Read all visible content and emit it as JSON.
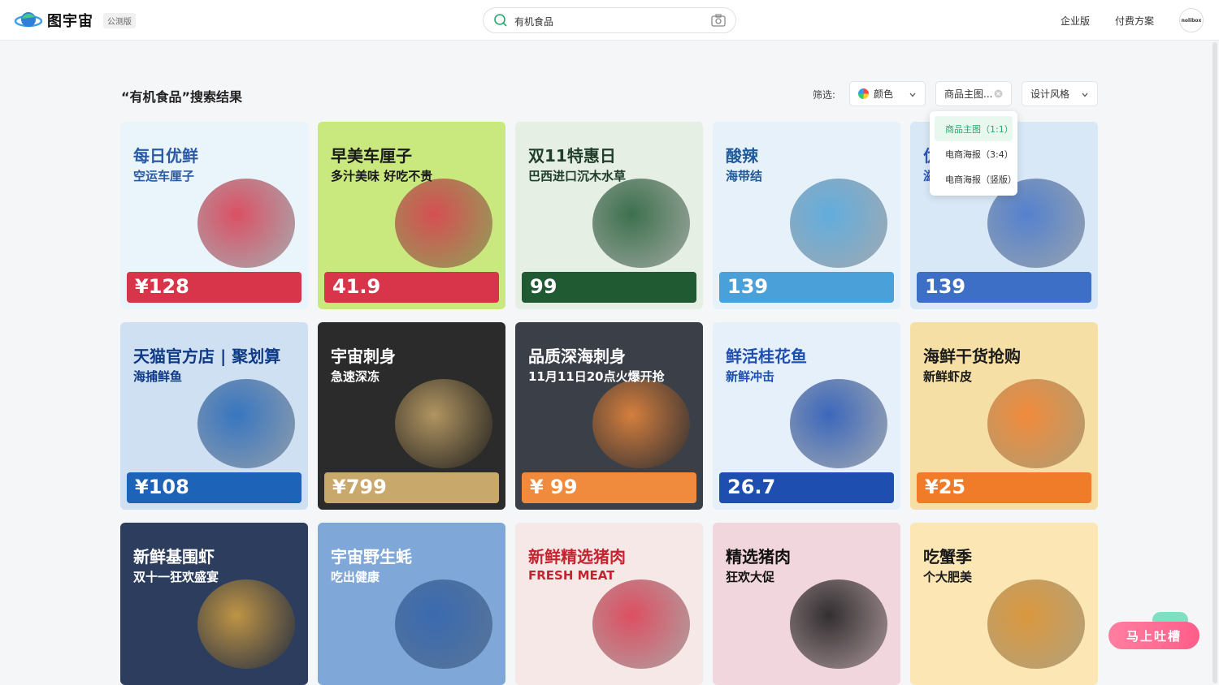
{
  "header": {
    "logo_text": "图宇宙",
    "beta_badge": "公测版",
    "search_value": "有机食品",
    "nav_enterprise": "企业版",
    "nav_pricing": "付费方案",
    "avatar_text": "nolibox"
  },
  "results": {
    "title": "“有机食品”搜索结果",
    "filter_label": "筛选:",
    "filter_color": "颜色",
    "filter_product": "商品主图...",
    "filter_style": "设计风格",
    "dropdown": [
      "商品主图（1:1）",
      "电商海报（3:4）",
      "电商海报（竖版）"
    ]
  },
  "cards": [
    {
      "t1": "每日优鲜",
      "t2": "空运车厘子",
      "price": "¥128",
      "bg": "#eaf5fb",
      "accent": "#d8344a",
      "tcolor": "#2b5aa3"
    },
    {
      "t1": "早美车厘子",
      "t2": "多汁美味 好吃不贵",
      "price": "41.9",
      "bg": "#c9e87e",
      "accent": "#d8344a",
      "tcolor": "#1a1a1a"
    },
    {
      "t1": "双11特惠日",
      "t2": "巴西进口沉木水草",
      "price": "99",
      "bg": "#e5efe4",
      "accent": "#1f5a33",
      "tcolor": "#1f3d29"
    },
    {
      "t1": "酸辣",
      "t2": "海带结",
      "price": "139",
      "bg": "#e7f1fa",
      "accent": "#4aa0d8",
      "tcolor": "#1f5a9a"
    },
    {
      "t1": "优质",
      "t2": "滋补海参",
      "price": "139",
      "bg": "#d9e8f7",
      "accent": "#3d6fc6",
      "tcolor": "#2d56b8"
    },
    {
      "t1": "天猫官方店 | 聚划算",
      "t2": "海捕鲜鱼",
      "price": "¥108",
      "bg": "#cfe0f3",
      "accent": "#1d63b7",
      "tcolor": "#0f3a85"
    },
    {
      "t1": "宇宙刺身",
      "t2": "急速深冻",
      "price": "¥799",
      "bg": "#2b2b2b",
      "accent": "#c9a86b",
      "tcolor": "#ffffff"
    },
    {
      "t1": "品质深海刺身",
      "t2": "11月11日20点火爆开抢",
      "price": "¥ 99",
      "bg": "#3a3f48",
      "accent": "#f08a3c",
      "tcolor": "#ffffff"
    },
    {
      "t1": "鲜活桂花鱼",
      "t2": "新鲜冲击",
      "price": "26.7",
      "bg": "#e6f0fb",
      "accent": "#1e4fb0",
      "tcolor": "#1e4fb0"
    },
    {
      "t1": "海鲜干货抢购",
      "t2": "新鲜虾皮",
      "price": "¥25",
      "bg": "#f6dfa5",
      "accent": "#f07c2a",
      "tcolor": "#1a1a1a"
    },
    {
      "t1": "新鲜基围虾",
      "t2": "双十一狂欢盛宴",
      "price": "",
      "bg": "#2c3d5e",
      "accent": "#d9a441",
      "tcolor": "#ffffff"
    },
    {
      "t1": "宇宙野生蚝",
      "t2": "吃出健康",
      "price": "",
      "bg": "#7fa7d8",
      "accent": "#2e5fa8",
      "tcolor": "#ffffff"
    },
    {
      "t1": "新鲜精选猪肉",
      "t2": "FRESH MEAT",
      "price": "",
      "bg": "#f7e8e8",
      "accent": "#d8344a",
      "tcolor": "#c4232f"
    },
    {
      "t1": "精选猪肉",
      "t2": "狂欢大促",
      "price": "",
      "bg": "#f2d6dd",
      "accent": "#111111",
      "tcolor": "#111111"
    },
    {
      "t1": "吃蟹季",
      "t2": "个大肥美",
      "price": "",
      "bg": "#fbe6b4",
      "accent": "#d58a2a",
      "tcolor": "#1a1a1a"
    }
  ],
  "feedback": "马上吐槽"
}
